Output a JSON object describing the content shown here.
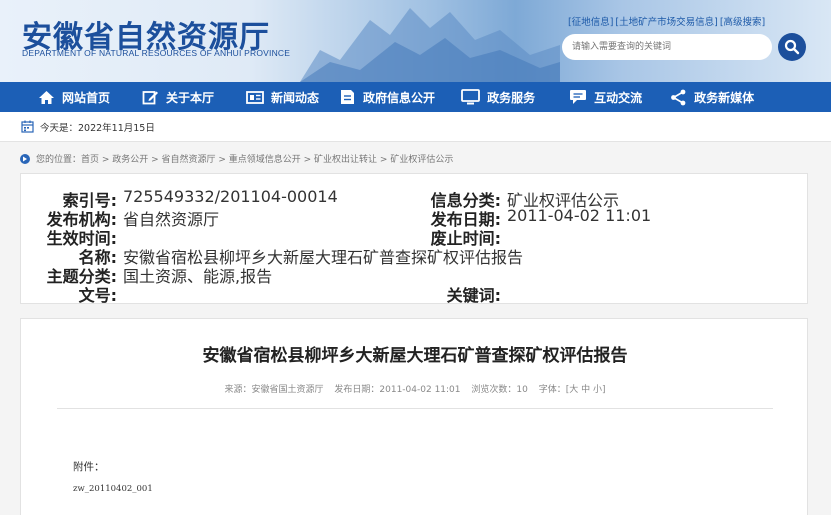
{
  "header": {
    "title_cn": "安徽省自然资源厅",
    "title_en": "DEPARTMENT OF NATURAL RESOURCES OF ANHUI PROVINCE",
    "top_links": [
      "[征地信息]",
      "[土地矿产市场交易信息]",
      "[高级搜索]"
    ],
    "search_placeholder": "请输入需要查询的关键词"
  },
  "nav": {
    "items": [
      {
        "label": "网站首页",
        "icon": "home-icon"
      },
      {
        "label": "关于本厅",
        "icon": "edit-icon"
      },
      {
        "label": "新闻动态",
        "icon": "newspaper-icon"
      },
      {
        "label": "政府信息公开",
        "icon": "document-icon"
      },
      {
        "label": "政务服务",
        "icon": "monitor-icon"
      },
      {
        "label": "互动交流",
        "icon": "chat-icon"
      },
      {
        "label": "政务新媒体",
        "icon": "share-icon"
      }
    ]
  },
  "date_line": {
    "text": "今天是：2022年11月15日"
  },
  "breadcrumb": {
    "text": "您的位置：首页 > 政务公开 > 省自然资源厅 > 重点领域信息公开 > 矿业权出让转让 > 矿业权评估公示"
  },
  "meta": {
    "index_label": "索引号:",
    "index_value": "725549332/201104-00014",
    "category_label": "信息分类:",
    "category_value": "矿业权评估公示",
    "publisher_label": "发布机构:",
    "publisher_value": "省自然资源厅",
    "pubdate_label": "发布日期:",
    "pubdate_value": "2011-04-02 11:01",
    "effective_label": "生效时间:",
    "effective_value": "",
    "expire_label": "废止时间:",
    "expire_value": "",
    "name_label": "名称:",
    "name_value": "安徽省宿松县柳坪乡大新屋大理石矿普查探矿权评估报告",
    "topic_label": "主题分类:",
    "topic_value": "国土资源、能源,报告",
    "docno_label": "文号:",
    "docno_value": "",
    "keywords_label": "关键词:",
    "keywords_value": ""
  },
  "article": {
    "title": "安徽省宿松县柳坪乡大新屋大理石矿普查探矿权评估报告",
    "source": "来源：安徽省国土资源厅",
    "date": "发布日期：2011-04-02 11:01",
    "views": "浏览次数：10",
    "font_label": "字体：",
    "font_sizes": "[大 中 小]",
    "attachment_label": "附件：",
    "attachment_file": "zw_20110402_001"
  },
  "colors": {
    "brand_blue": "#1c5fb6",
    "title_blue": "#1c4f9c"
  }
}
